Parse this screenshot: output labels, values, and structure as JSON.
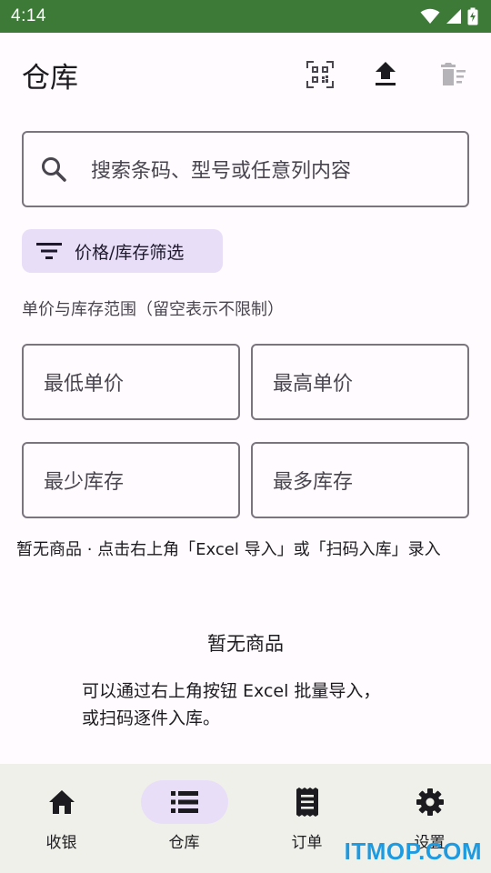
{
  "status_bar": {
    "time": "4:14"
  },
  "header": {
    "title": "仓库",
    "actions": [
      "qr-scan-icon",
      "upload-icon",
      "delete-sweep-icon"
    ]
  },
  "search": {
    "placeholder": "搜索条码、型号或任意列内容"
  },
  "filter_chip": {
    "label": "价格/库存筛选"
  },
  "range": {
    "label": "单价与库存范围（留空表示不限制）",
    "min_price": "最低单价",
    "max_price": "最高单价",
    "min_stock": "最少库存",
    "max_stock": "最多库存"
  },
  "hint": "暂无商品 · 点击右上角「Excel 导入」或「扫码入库」录入",
  "empty_state": {
    "title": "暂无商品",
    "line1": "可以通过右上角按钮 Excel 批量导入，",
    "line2": "或扫码逐件入库。"
  },
  "bottom_nav": [
    {
      "label": "收银",
      "icon": "home-icon",
      "active": false
    },
    {
      "label": "仓库",
      "icon": "list-icon",
      "active": true
    },
    {
      "label": "订单",
      "icon": "receipt-icon",
      "active": false
    },
    {
      "label": "设置",
      "icon": "gear-icon",
      "active": false
    }
  ],
  "watermark": "ITMOP.COM",
  "colors": {
    "status_bar": "#3d7a38",
    "accent_container": "#e8def8",
    "nav_bg": "#f0f0ea",
    "watermark": "#1e9be0"
  }
}
